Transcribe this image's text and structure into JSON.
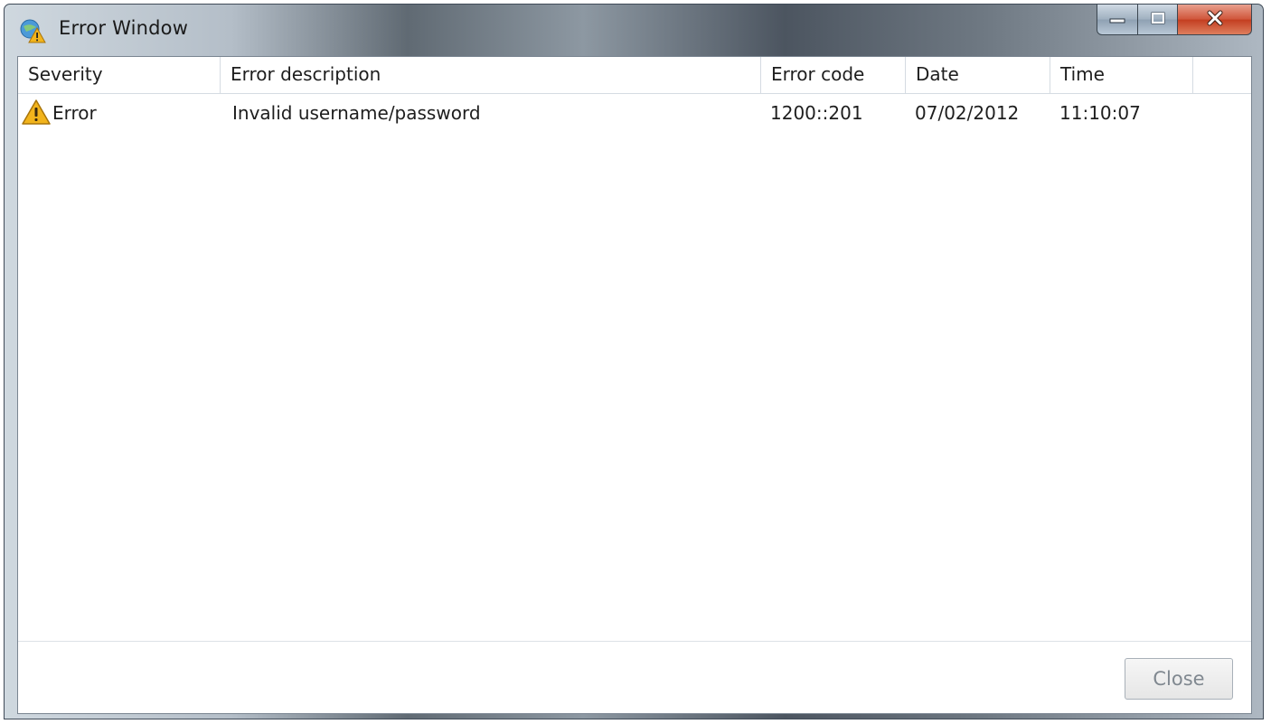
{
  "window": {
    "title": "Error Window",
    "app_icon": "globe-warning-icon"
  },
  "caption": {
    "minimize_icon": "minimize-icon",
    "maximize_icon": "maximize-icon",
    "close_icon": "close-icon",
    "close_color": "#c9452a"
  },
  "table": {
    "columns": [
      "Severity",
      "Error description",
      "Error code",
      "Date",
      "Time"
    ],
    "rows": [
      {
        "severity": "Error",
        "severity_icon": "warning-icon",
        "description": "Invalid username/password",
        "code": "1200::201",
        "date": "07/02/2012",
        "time": "11:10:07"
      }
    ]
  },
  "footer": {
    "close_label": "Close"
  },
  "colors": {
    "warning": "#f2b41c"
  }
}
